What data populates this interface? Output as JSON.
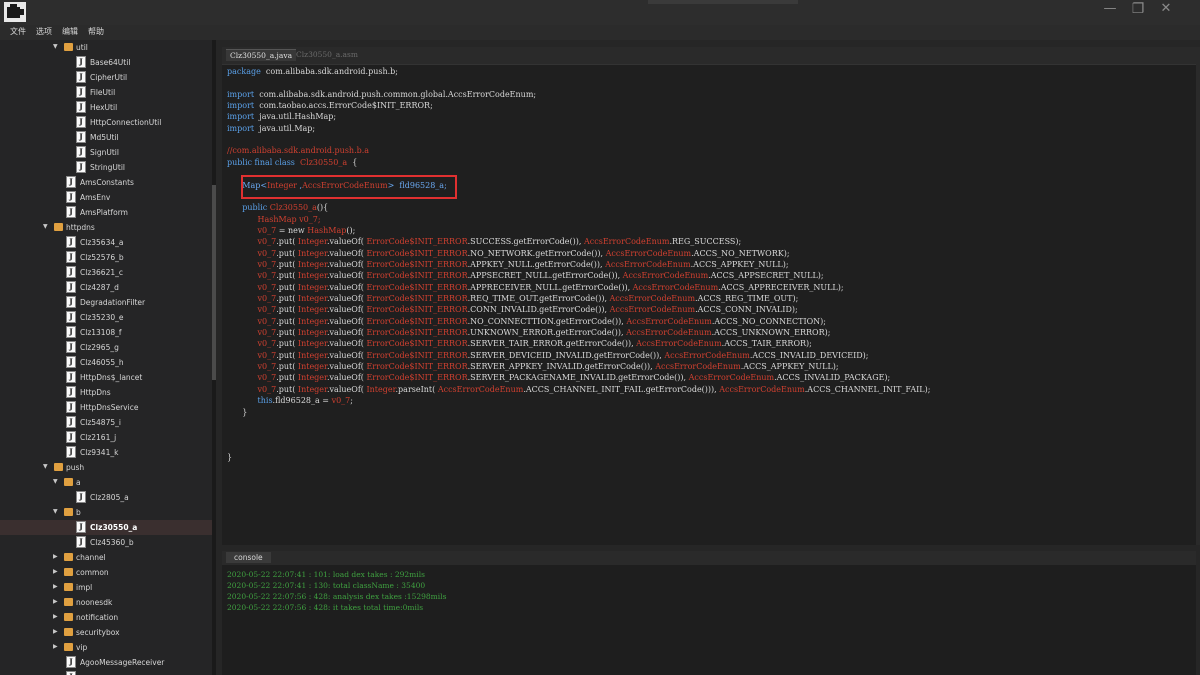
{
  "menu": [
    "文件",
    "选项",
    "编辑",
    "帮助"
  ],
  "window_controls": {
    "minimize": "—",
    "restore": "❐",
    "close": "✕"
  },
  "tree": [
    {
      "label": "util",
      "type": "pkg",
      "level": 4,
      "expanded": true
    },
    {
      "label": "Base64Util",
      "type": "file",
      "level": 5
    },
    {
      "label": "CipherUtil",
      "type": "file",
      "level": 5
    },
    {
      "label": "FileUtil",
      "type": "file",
      "level": 5
    },
    {
      "label": "HexUtil",
      "type": "file",
      "level": 5
    },
    {
      "label": "HttpConnectionUtil",
      "type": "file",
      "level": 5
    },
    {
      "label": "Md5Util",
      "type": "file",
      "level": 5
    },
    {
      "label": "SignUtil",
      "type": "file",
      "level": 5
    },
    {
      "label": "StringUtil",
      "type": "file",
      "level": 5
    },
    {
      "label": "AmsConstants",
      "type": "file",
      "level": 4
    },
    {
      "label": "AmsEnv",
      "type": "file",
      "level": 4
    },
    {
      "label": "AmsPlatform",
      "type": "file",
      "level": 4
    },
    {
      "label": "httpdns",
      "type": "pkg",
      "level": 3,
      "expanded": true
    },
    {
      "label": "Clz35634_a",
      "type": "file",
      "level": 4
    },
    {
      "label": "Clz52576_b",
      "type": "file",
      "level": 4
    },
    {
      "label": "Clz36621_c",
      "type": "file",
      "level": 4
    },
    {
      "label": "Clz4287_d",
      "type": "file",
      "level": 4
    },
    {
      "label": "DegradationFilter",
      "type": "file",
      "level": 4
    },
    {
      "label": "Clz35230_e",
      "type": "file",
      "level": 4
    },
    {
      "label": "Clz13108_f",
      "type": "file",
      "level": 4
    },
    {
      "label": "Clz2965_g",
      "type": "file",
      "level": 4
    },
    {
      "label": "Clz46055_h",
      "type": "file",
      "level": 4
    },
    {
      "label": "HttpDns$_lancet",
      "type": "file",
      "level": 4
    },
    {
      "label": "HttpDns",
      "type": "file",
      "level": 4
    },
    {
      "label": "HttpDnsService",
      "type": "file",
      "level": 4
    },
    {
      "label": "Clz54875_i",
      "type": "file",
      "level": 4
    },
    {
      "label": "Clz2161_j",
      "type": "file",
      "level": 4
    },
    {
      "label": "Clz9341_k",
      "type": "file",
      "level": 4
    },
    {
      "label": "push",
      "type": "pkg",
      "level": 3,
      "expanded": true
    },
    {
      "label": "a",
      "type": "pkg",
      "level": 4,
      "expanded": true
    },
    {
      "label": "Clz2805_a",
      "type": "file",
      "level": 5
    },
    {
      "label": "b",
      "type": "pkg",
      "level": 4,
      "expanded": true
    },
    {
      "label": "Clz30550_a",
      "type": "file",
      "level": 5,
      "selected": true
    },
    {
      "label": "Clz45360_b",
      "type": "file",
      "level": 5
    },
    {
      "label": "channel",
      "type": "pkg",
      "level": 4,
      "expanded": false
    },
    {
      "label": "common",
      "type": "pkg",
      "level": 4,
      "expanded": false
    },
    {
      "label": "impl",
      "type": "pkg",
      "level": 4,
      "expanded": false
    },
    {
      "label": "noonesdk",
      "type": "pkg",
      "level": 4,
      "expanded": false
    },
    {
      "label": "notification",
      "type": "pkg",
      "level": 4,
      "expanded": false
    },
    {
      "label": "securitybox",
      "type": "pkg",
      "level": 4,
      "expanded": false
    },
    {
      "label": "vip",
      "type": "pkg",
      "level": 4,
      "expanded": false
    },
    {
      "label": "AgooMessageReceiver",
      "type": "file",
      "level": 4
    },
    {
      "label": "",
      "type": "file",
      "level": 4
    }
  ],
  "tabs": {
    "active": "Clz30550_a.java",
    "inactive": "Clz30550_a.asm"
  },
  "code": [
    {
      "row": 0,
      "segs": [
        [
          "kw",
          "package"
        ],
        [
          "fn",
          "  com.alibaba.sdk.android.push.b;"
        ]
      ]
    },
    {
      "row": 2,
      "segs": [
        [
          "kw",
          "import"
        ],
        [
          "fn",
          "  com.alibaba.sdk.android.push.common.global.AccsErrorCodeEnum;"
        ]
      ]
    },
    {
      "row": 3,
      "segs": [
        [
          "kw",
          "import"
        ],
        [
          "fn",
          "  com.taobao.accs.ErrorCode$INIT_ERROR;"
        ]
      ]
    },
    {
      "row": 4,
      "segs": [
        [
          "kw",
          "import"
        ],
        [
          "fn",
          "  java.util.HashMap;"
        ]
      ]
    },
    {
      "row": 5,
      "segs": [
        [
          "kw",
          "import"
        ],
        [
          "fn",
          "  java.util.Map;"
        ]
      ]
    },
    {
      "row": 7,
      "segs": [
        [
          "cm",
          "//com.alibaba.sdk.android.push.b.a"
        ]
      ]
    },
    {
      "row": 8,
      "segs": [
        [
          "kw",
          "public final class"
        ],
        [
          "red",
          "  Clz30550_a"
        ],
        [
          "fn",
          "  {"
        ]
      ]
    },
    {
      "row": 10,
      "segs": [
        [
          "fn",
          "      "
        ],
        [
          "blue",
          "Map<"
        ],
        [
          "red",
          "Integer"
        ],
        [
          "blue",
          " ,"
        ],
        [
          "red",
          "AccsErrorCodeEnum"
        ],
        [
          "blue",
          ">  fld96528_a;"
        ]
      ]
    },
    {
      "row": 12,
      "segs": [
        [
          "kw",
          "      public"
        ],
        [
          "red",
          " Clz30550_a"
        ],
        [
          "fn",
          "(){"
        ]
      ]
    },
    {
      "row": 13,
      "segs": [
        [
          "fn",
          "            "
        ],
        [
          "red",
          "HashMap v0_7;"
        ]
      ]
    },
    {
      "row": 14,
      "segs": [
        [
          "fn",
          "            "
        ],
        [
          "red",
          "v0_7"
        ],
        [
          "fn",
          " = new "
        ],
        [
          "red",
          "HashMap"
        ],
        [
          "fn",
          "();"
        ]
      ]
    },
    {
      "row": 15,
      "segs": [
        [
          "fn",
          "            "
        ],
        [
          "red",
          "v0_7"
        ],
        [
          "fn",
          ".put( "
        ],
        [
          "red",
          "Integer"
        ],
        [
          "fn",
          ".valueOf( "
        ],
        [
          "red",
          "ErrorCode$INIT_ERROR"
        ],
        [
          "fn",
          ".SUCCESS.getErrorCode()), "
        ],
        [
          "red",
          "AccsErrorCodeEnum"
        ],
        [
          "fn",
          ".REG_SUCCESS);"
        ]
      ]
    },
    {
      "row": 16,
      "segs": [
        [
          "fn",
          "            "
        ],
        [
          "red",
          "v0_7"
        ],
        [
          "fn",
          ".put( "
        ],
        [
          "red",
          "Integer"
        ],
        [
          "fn",
          ".valueOf( "
        ],
        [
          "red",
          "ErrorCode$INIT_ERROR"
        ],
        [
          "fn",
          ".NO_NETWORK.getErrorCode()), "
        ],
        [
          "red",
          "AccsErrorCodeEnum"
        ],
        [
          "fn",
          ".ACCS_NO_NETWORK);"
        ]
      ]
    },
    {
      "row": 17,
      "segs": [
        [
          "fn",
          "            "
        ],
        [
          "red",
          "v0_7"
        ],
        [
          "fn",
          ".put( "
        ],
        [
          "red",
          "Integer"
        ],
        [
          "fn",
          ".valueOf( "
        ],
        [
          "red",
          "ErrorCode$INIT_ERROR"
        ],
        [
          "fn",
          ".APPKEY_NULL.getErrorCode()), "
        ],
        [
          "red",
          "AccsErrorCodeEnum"
        ],
        [
          "fn",
          ".ACCS_APPKEY_NULL);"
        ]
      ]
    },
    {
      "row": 18,
      "segs": [
        [
          "fn",
          "            "
        ],
        [
          "red",
          "v0_7"
        ],
        [
          "fn",
          ".put( "
        ],
        [
          "red",
          "Integer"
        ],
        [
          "fn",
          ".valueOf( "
        ],
        [
          "red",
          "ErrorCode$INIT_ERROR"
        ],
        [
          "fn",
          ".APPSECRET_NULL.getErrorCode()), "
        ],
        [
          "red",
          "AccsErrorCodeEnum"
        ],
        [
          "fn",
          ".ACCS_APPSECRET_NULL);"
        ]
      ]
    },
    {
      "row": 19,
      "segs": [
        [
          "fn",
          "            "
        ],
        [
          "red",
          "v0_7"
        ],
        [
          "fn",
          ".put( "
        ],
        [
          "red",
          "Integer"
        ],
        [
          "fn",
          ".valueOf( "
        ],
        [
          "red",
          "ErrorCode$INIT_ERROR"
        ],
        [
          "fn",
          ".APPRECEIVER_NULL.getErrorCode()), "
        ],
        [
          "red",
          "AccsErrorCodeEnum"
        ],
        [
          "fn",
          ".ACCS_APPRECEIVER_NULL);"
        ]
      ]
    },
    {
      "row": 20,
      "segs": [
        [
          "fn",
          "            "
        ],
        [
          "red",
          "v0_7"
        ],
        [
          "fn",
          ".put( "
        ],
        [
          "red",
          "Integer"
        ],
        [
          "fn",
          ".valueOf( "
        ],
        [
          "red",
          "ErrorCode$INIT_ERROR"
        ],
        [
          "fn",
          ".REQ_TIME_OUT.getErrorCode()), "
        ],
        [
          "red",
          "AccsErrorCodeEnum"
        ],
        [
          "fn",
          ".ACCS_REG_TIME_OUT);"
        ]
      ]
    },
    {
      "row": 21,
      "segs": [
        [
          "fn",
          "            "
        ],
        [
          "red",
          "v0_7"
        ],
        [
          "fn",
          ".put( "
        ],
        [
          "red",
          "Integer"
        ],
        [
          "fn",
          ".valueOf( "
        ],
        [
          "red",
          "ErrorCode$INIT_ERROR"
        ],
        [
          "fn",
          ".CONN_INVALID.getErrorCode()), "
        ],
        [
          "red",
          "AccsErrorCodeEnum"
        ],
        [
          "fn",
          ".ACCS_CONN_INVALID);"
        ]
      ]
    },
    {
      "row": 22,
      "segs": [
        [
          "fn",
          "            "
        ],
        [
          "red",
          "v0_7"
        ],
        [
          "fn",
          ".put( "
        ],
        [
          "red",
          "Integer"
        ],
        [
          "fn",
          ".valueOf( "
        ],
        [
          "red",
          "ErrorCode$INIT_ERROR"
        ],
        [
          "fn",
          ".NO_CONNECTTION.getErrorCode()), "
        ],
        [
          "red",
          "AccsErrorCodeEnum"
        ],
        [
          "fn",
          ".ACCS_NO_CONNECTION);"
        ]
      ]
    },
    {
      "row": 23,
      "segs": [
        [
          "fn",
          "            "
        ],
        [
          "red",
          "v0_7"
        ],
        [
          "fn",
          ".put( "
        ],
        [
          "red",
          "Integer"
        ],
        [
          "fn",
          ".valueOf( "
        ],
        [
          "red",
          "ErrorCode$INIT_ERROR"
        ],
        [
          "fn",
          ".UNKNOWN_ERROR.getErrorCode()), "
        ],
        [
          "red",
          "AccsErrorCodeEnum"
        ],
        [
          "fn",
          ".ACCS_UNKNOWN_ERROR);"
        ]
      ]
    },
    {
      "row": 24,
      "segs": [
        [
          "fn",
          "            "
        ],
        [
          "red",
          "v0_7"
        ],
        [
          "fn",
          ".put( "
        ],
        [
          "red",
          "Integer"
        ],
        [
          "fn",
          ".valueOf( "
        ],
        [
          "red",
          "ErrorCode$INIT_ERROR"
        ],
        [
          "fn",
          ".SERVER_TAIR_ERROR.getErrorCode()), "
        ],
        [
          "red",
          "AccsErrorCodeEnum"
        ],
        [
          "fn",
          ".ACCS_TAIR_ERROR);"
        ]
      ]
    },
    {
      "row": 25,
      "segs": [
        [
          "fn",
          "            "
        ],
        [
          "red",
          "v0_7"
        ],
        [
          "fn",
          ".put( "
        ],
        [
          "red",
          "Integer"
        ],
        [
          "fn",
          ".valueOf( "
        ],
        [
          "red",
          "ErrorCode$INIT_ERROR"
        ],
        [
          "fn",
          ".SERVER_DEVICEID_INVALID.getErrorCode()), "
        ],
        [
          "red",
          "AccsErrorCodeEnum"
        ],
        [
          "fn",
          ".ACCS_INVALID_DEVICEID);"
        ]
      ]
    },
    {
      "row": 26,
      "segs": [
        [
          "fn",
          "            "
        ],
        [
          "red",
          "v0_7"
        ],
        [
          "fn",
          ".put( "
        ],
        [
          "red",
          "Integer"
        ],
        [
          "fn",
          ".valueOf( "
        ],
        [
          "red",
          "ErrorCode$INIT_ERROR"
        ],
        [
          "fn",
          ".SERVER_APPKEY_INVALID.getErrorCode()), "
        ],
        [
          "red",
          "AccsErrorCodeEnum"
        ],
        [
          "fn",
          ".ACCS_APPKEY_NULL);"
        ]
      ]
    },
    {
      "row": 27,
      "segs": [
        [
          "fn",
          "            "
        ],
        [
          "red",
          "v0_7"
        ],
        [
          "fn",
          ".put( "
        ],
        [
          "red",
          "Integer"
        ],
        [
          "fn",
          ".valueOf( "
        ],
        [
          "red",
          "ErrorCode$INIT_ERROR"
        ],
        [
          "fn",
          ".SERVER_PACKAGENAME_INVALID.getErrorCode()), "
        ],
        [
          "red",
          "AccsErrorCodeEnum"
        ],
        [
          "fn",
          ".ACCS_INVALID_PACKAGE);"
        ]
      ]
    },
    {
      "row": 28,
      "segs": [
        [
          "fn",
          "            "
        ],
        [
          "red",
          "v0_7"
        ],
        [
          "fn",
          ".put( "
        ],
        [
          "red",
          "Integer"
        ],
        [
          "fn",
          ".valueOf( "
        ],
        [
          "red",
          "Integer"
        ],
        [
          "fn",
          ".parseInt( "
        ],
        [
          "red",
          "AccsErrorCodeEnum"
        ],
        [
          "fn",
          ".ACCS_CHANNEL_INIT_FAIL.getErrorCode())), "
        ],
        [
          "red",
          "AccsErrorCodeEnum"
        ],
        [
          "fn",
          ".ACCS_CHANNEL_INIT_FAIL);"
        ]
      ]
    },
    {
      "row": 29,
      "segs": [
        [
          "kw",
          "            this"
        ],
        [
          "fn",
          ".fld96528_a = "
        ],
        [
          "red",
          "v0_7"
        ],
        [
          "fn",
          ";"
        ]
      ]
    },
    {
      "row": 30,
      "segs": [
        [
          "fn",
          "      }"
        ]
      ]
    },
    {
      "row": 34,
      "segs": [
        [
          "fn",
          "}"
        ]
      ]
    }
  ],
  "console": {
    "tab": "console",
    "logs": [
      "2020-05-22 22:07:41 : 101: load dex takes :  292mils",
      "2020-05-22 22:07:41 : 130: total className :  35400",
      "2020-05-22 22:07:56 : 428: analysis dex takes :15298mils",
      "2020-05-22 22:07:56 : 428: it takes total time:0mils"
    ]
  }
}
